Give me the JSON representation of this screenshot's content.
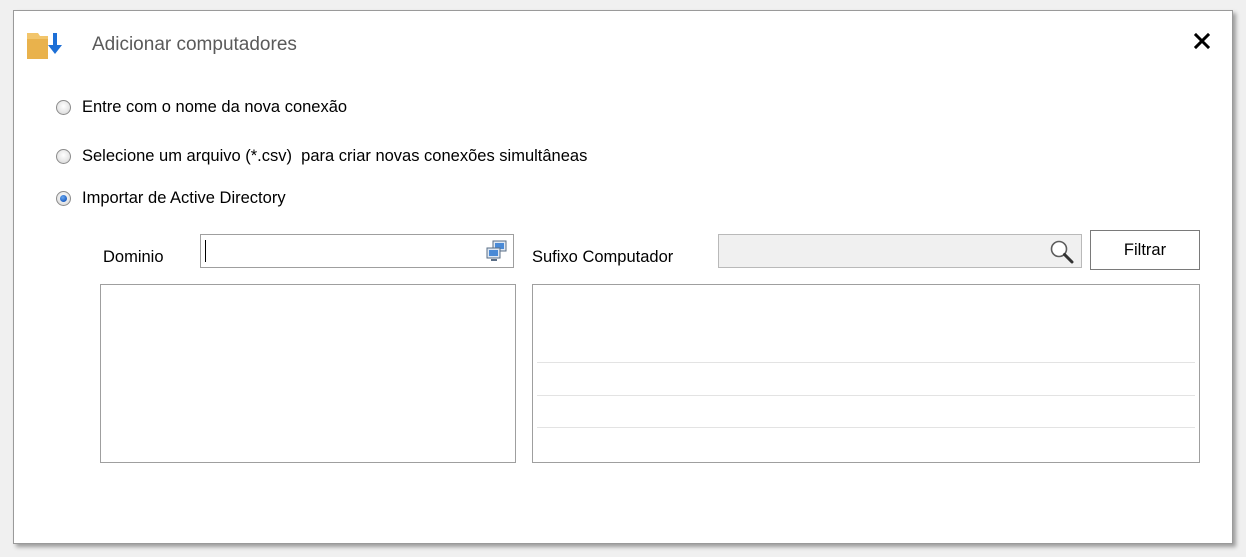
{
  "dialog": {
    "title": "Adicionar computadores",
    "icons": {
      "title_icon": "folder-download-icon",
      "close_icon": "close-icon",
      "domain_browse_icon": "network-computers-icon",
      "search_icon": "search-icon"
    },
    "close_glyph": "✕"
  },
  "options": {
    "new_connection_label": "Entre com o nome da nova conexão",
    "csv_label": "Selecione um arquivo (*.csv)  para criar novas conexões simultâneas",
    "active_directory_label": "Importar de Active Directory",
    "selected": "active_directory"
  },
  "ad": {
    "domain_label": "Dominio",
    "domain_value": "",
    "suffix_label": "Sufixo Computador",
    "suffix_value": "",
    "filter_button": "Filtrar",
    "domain_list_items": [],
    "computer_list_items": []
  },
  "colors": {
    "accent_blue": "#1d5fc4",
    "folder_yellow": "#f2c56b"
  }
}
